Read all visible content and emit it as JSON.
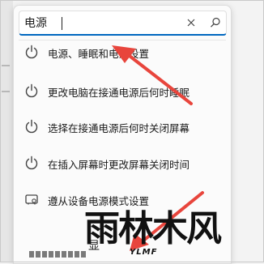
{
  "search": {
    "value": "电源",
    "placeholder": ""
  },
  "results": [
    {
      "label": "电源、睡眠和电池设置",
      "icon": "power-icon"
    },
    {
      "label": "更改电脑在接通电源后何时睡眠",
      "icon": "power-icon"
    },
    {
      "label": "选择在接通电源后何时关闭屏幕",
      "icon": "power-icon"
    },
    {
      "label": "在插入屏幕时更改屏幕关闭时间",
      "icon": "power-icon"
    },
    {
      "label": "遵从设备电源模式设置",
      "icon": "device-settings-icon"
    }
  ],
  "bottom_button": {
    "label": "显"
  },
  "watermark": {
    "chinese": "雨林木风",
    "english": "YLMF"
  },
  "colors": {
    "accent": "#0067c0",
    "arrow": "#e8453c",
    "icon": "#444444"
  }
}
